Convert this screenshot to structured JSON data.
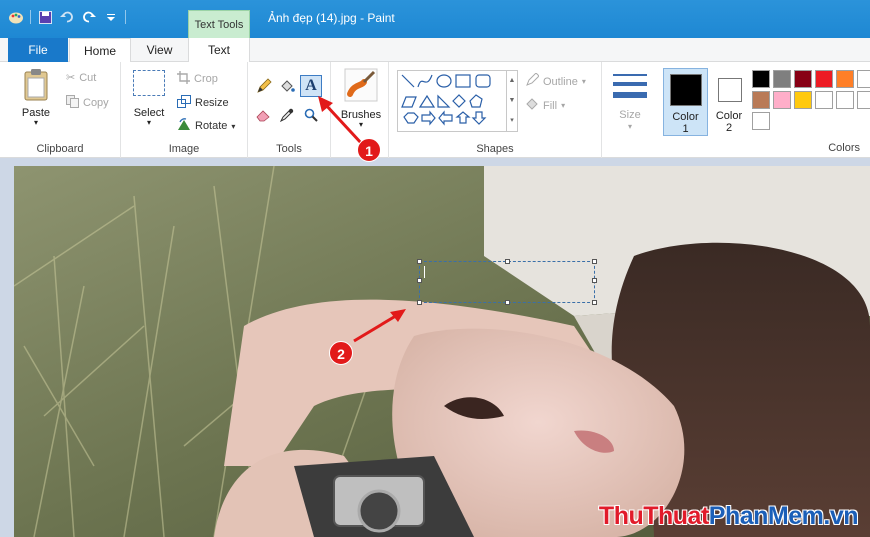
{
  "window": {
    "title": "Ảnh đẹp (14).jpg - Paint",
    "context_tab": "Text Tools"
  },
  "tabs": {
    "file": "File",
    "home": "Home",
    "view": "View",
    "text": "Text"
  },
  "ribbon": {
    "clipboard": {
      "label": "Clipboard",
      "paste": "Paste",
      "cut": "Cut",
      "copy": "Copy"
    },
    "image": {
      "label": "Image",
      "select": "Select",
      "crop": "Crop",
      "resize": "Resize",
      "rotate": "Rotate"
    },
    "tools": {
      "label": "Tools"
    },
    "brushes": {
      "label": "Brushes"
    },
    "shapes": {
      "label": "Shapes",
      "outline": "Outline",
      "fill": "Fill"
    },
    "size": {
      "label": "Size"
    },
    "color1": {
      "label": "Color",
      "number": "1"
    },
    "color2": {
      "label": "Color",
      "number": "2"
    },
    "colors": {
      "label": "Colors"
    }
  },
  "palette": [
    "#000000",
    "#7f7f7f",
    "#880015",
    "#ed1c24",
    "#ff7f27",
    "#ffffff",
    "#c3c3c3",
    "#b97a57",
    "#ffaec9",
    "#ffc90e",
    "#ffffff",
    "#ffffff",
    "#ffffff",
    "#ffffff",
    "#ffffff"
  ],
  "annotations": {
    "callout1": "1",
    "callout2": "2"
  },
  "watermark": {
    "part1": "ThuThuat",
    "part2": "PhanMem",
    "part3": ".vn"
  }
}
